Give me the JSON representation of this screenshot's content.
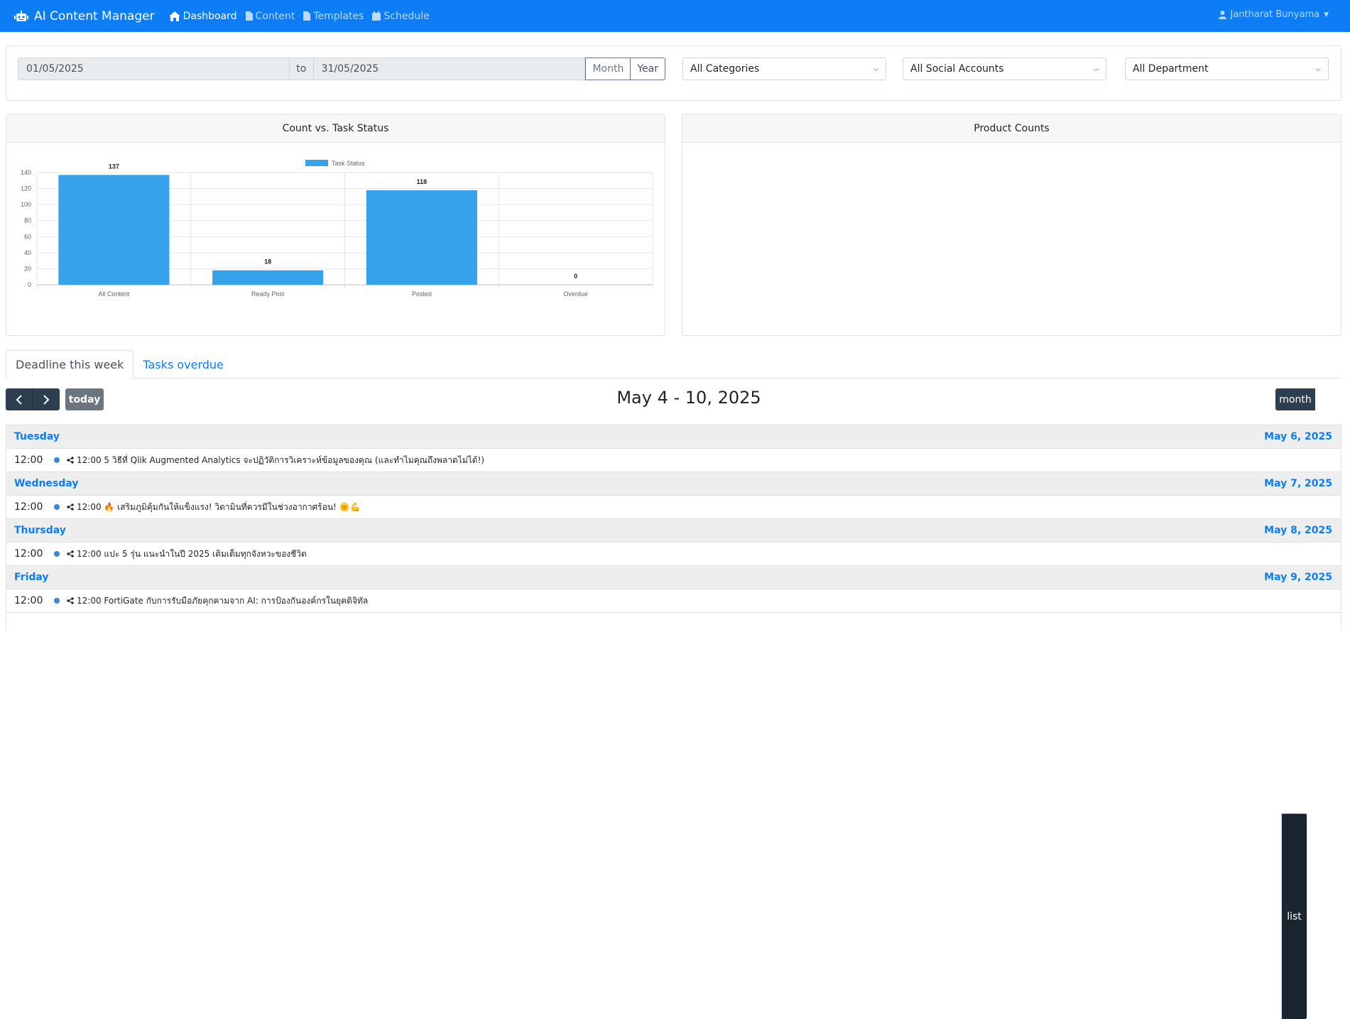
{
  "navbar": {
    "brand": "AI Content Manager",
    "links": [
      "Dashboard",
      "Content",
      "Templates",
      "Schedule"
    ],
    "user": "Jantharat Bunyama"
  },
  "filters": {
    "date_start": "01/05/2025",
    "date_to": "to",
    "date_end": "31/05/2025",
    "month_btn": "Month",
    "year_btn": "Year",
    "categories": "All Categories",
    "social_accounts": "All Social Accounts",
    "department": "All Department"
  },
  "cards": {
    "chart_title": "Count vs. Task Status",
    "product_title": "Product Counts"
  },
  "chart_data": {
    "type": "bar",
    "title": "Count vs. Task Status",
    "categories": [
      "All Content",
      "Ready Post",
      "Posted",
      "Overdue"
    ],
    "series": [
      {
        "name": "Task Status",
        "values": [
          137,
          18,
          118,
          0
        ]
      }
    ],
    "ylim": [
      0,
      140
    ],
    "yticks": [
      "0",
      "20",
      "40",
      "60",
      "80",
      "100",
      "120",
      "140"
    ],
    "grid": true,
    "legend": "top-center",
    "color": "#36a2eb"
  },
  "tabs": [
    "Deadline this week",
    "Tasks overdue"
  ],
  "calendar": {
    "prev": "‹",
    "next": "›",
    "today": "today",
    "title": "May 4 - 10, 2025",
    "view_month": "month",
    "view_list": "list",
    "days": [
      {
        "name": "Tuesday",
        "date": "May 6, 2025",
        "time": "12:00",
        "event": "12:00 5 วิธีที่ Qlik Augmented Analytics จะปฏิวัติการวิเคราะห์ข้อมูลของคุณ (และทำไมคุณถึงพลาดไม่ได้!)"
      },
      {
        "name": "Wednesday",
        "date": "May 7, 2025",
        "time": "12:00",
        "event": "12:00 🔥 เสริมภูมิคุ้มกันให้แข็งแรง! วิตามินที่ควรมีในช่วงอากาศร้อน! 🌞💪"
      },
      {
        "name": "Thursday",
        "date": "May 8, 2025",
        "time": "12:00",
        "event": "12:00 แปะ 5 รุ่น แนะนำในปี 2025 เติมเต็มทุกจังหวะของชีวิต"
      },
      {
        "name": "Friday",
        "date": "May 9, 2025",
        "time": "12:00",
        "event": "12:00 FortiGate กับการรับมือภัยคุกคามจาก AI: การป้องกันองค์กรในยุคดิจิทัล"
      }
    ]
  }
}
